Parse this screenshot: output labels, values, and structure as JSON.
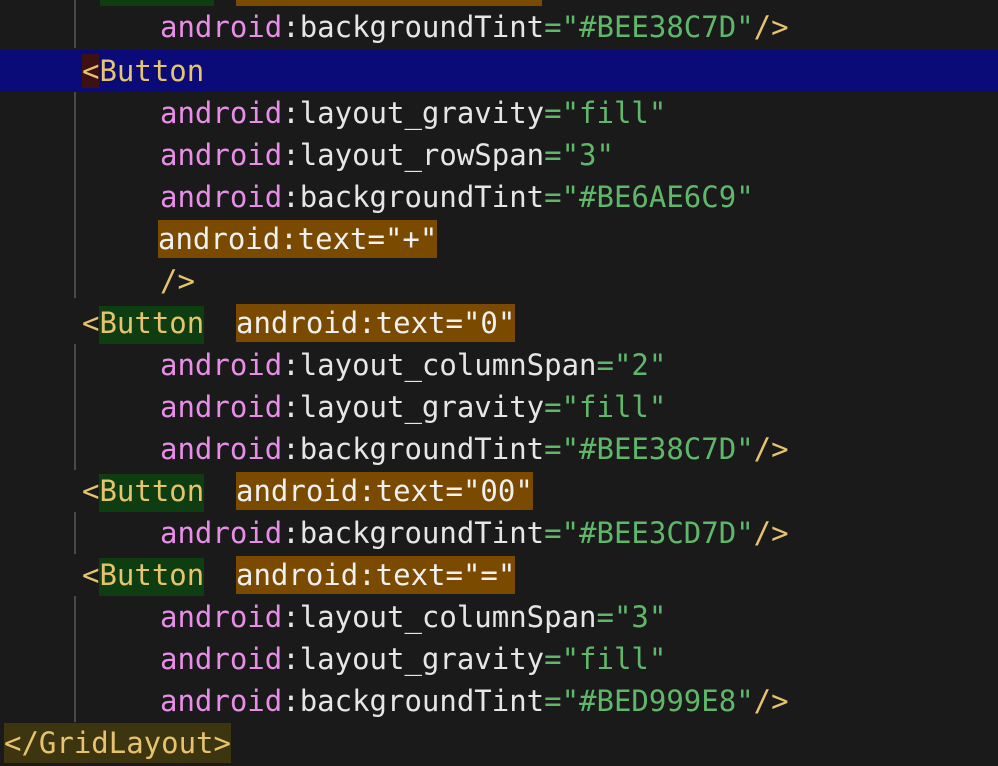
{
  "editor": {
    "attr_ns": "android",
    "lines": {
      "l0": {
        "name": "backgroundTint",
        "value": "\"#BEE38C7D\"",
        "close": "/>"
      },
      "l1": {
        "open": "<",
        "tag": "Button"
      },
      "l2": {
        "name": "layout_gravity",
        "value": "\"fill\""
      },
      "l3": {
        "name": "layout_rowSpan",
        "value": "\"3\""
      },
      "l4": {
        "name": "backgroundTint",
        "value": "\"#BE6AE6C9\""
      },
      "l5": {
        "highlight": "android:text=\"+\""
      },
      "l6": {
        "close": "/>"
      },
      "l7": {
        "open": "<",
        "tag": "Button",
        "highlight": "android:text=\"0\""
      },
      "l8": {
        "name": "layout_columnSpan",
        "value": "\"2\""
      },
      "l9": {
        "name": "layout_gravity",
        "value": "\"fill\""
      },
      "l10": {
        "name": "backgroundTint",
        "value": "\"#BEE38C7D\"",
        "close": "/>"
      },
      "l11": {
        "open": "<",
        "tag": "Button",
        "highlight": "android:text=\"00\""
      },
      "l12": {
        "name": "backgroundTint",
        "value": "\"#BEE3CD7D\"",
        "close": "/>"
      },
      "l13": {
        "open": "<",
        "tag": "Button",
        "highlight": "android:text=\"=\""
      },
      "l14": {
        "name": "layout_columnSpan",
        "value": "\"3\""
      },
      "l15": {
        "name": "layout_gravity",
        "value": "\"fill\""
      },
      "l16": {
        "name": "backgroundTint",
        "value": "\"#BED999E8\"",
        "close": "/>"
      },
      "l17": {
        "close_tag": "</GridLayout>"
      }
    },
    "colors": {
      "background": "#1a1a1a",
      "current_line": "#0a0a78",
      "attribute": "#e88ee8",
      "value": "#5fb86a",
      "tag": "#e6c46e",
      "tag_highlight": "#0d3d10",
      "text_highlight": "#7a4a00"
    }
  }
}
